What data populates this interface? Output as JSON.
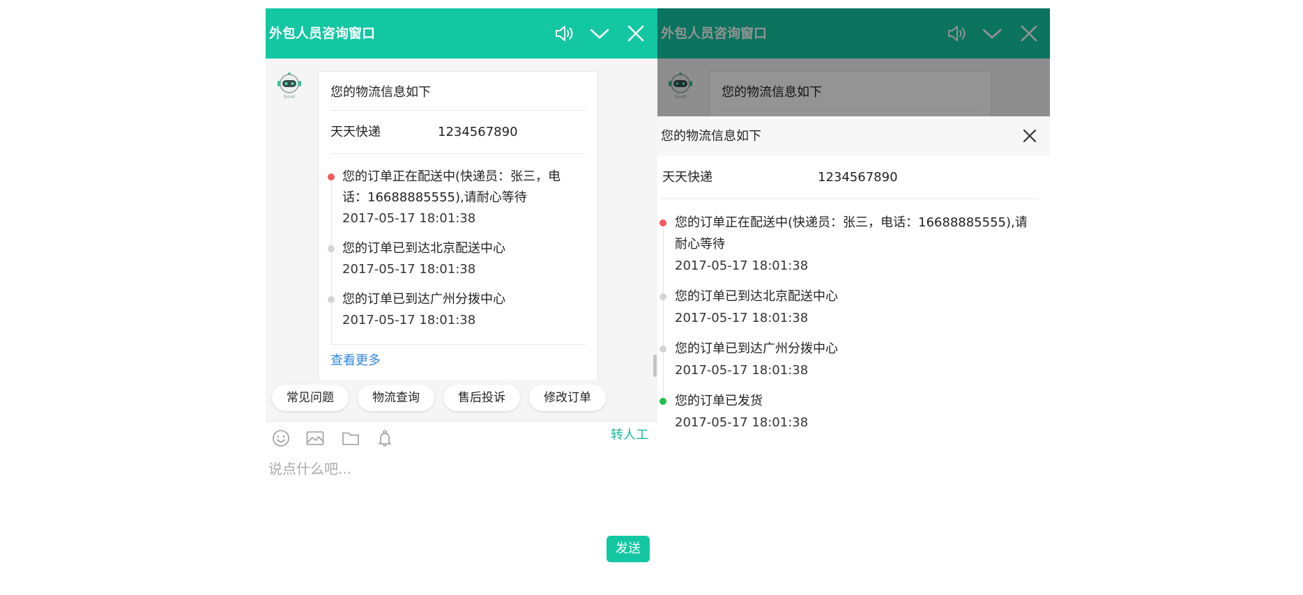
{
  "app": {
    "title": "外包人员咨询窗口",
    "accent_color": "#13c7a3",
    "header_icons": [
      "speaker-icon",
      "chevron-down-icon",
      "close-icon"
    ]
  },
  "chat": {
    "logistics_card": {
      "title": "您的物流信息如下",
      "carrier": "天天快递",
      "tracking_number": "1234567890",
      "events": [
        {
          "text": "您的订单正在配送中(快递员：张三，电话：16688885555),请耐心等待",
          "time": "2017-05-17 18:01:38",
          "dot_color": "#f25c5c"
        },
        {
          "text": "您的订单已到达北京配送中心",
          "time": "2017-05-17 18:01:38",
          "dot_color": "#d4d4d4"
        },
        {
          "text": "您的订单已到达广州分拨中心",
          "time": "2017-05-17 18:01:38",
          "dot_color": "#d4d4d4"
        }
      ],
      "more_link": "查看更多"
    },
    "quick_replies": [
      "常见问题",
      "物流查询",
      "售后投诉",
      "修改订单"
    ],
    "toolbar": {
      "icons": [
        "emoji-icon",
        "image-icon",
        "folder-icon",
        "bell-icon"
      ],
      "transfer_label": "转人工"
    },
    "input": {
      "placeholder": "说点什么吧...",
      "value": ""
    },
    "send_label": "发送"
  },
  "detail_panel": {
    "title": "您的物流信息如下",
    "carrier": "天天快递",
    "tracking_number": "1234567890",
    "events": [
      {
        "text": "您的订单正在配送中(快递员：张三，电话：16688885555),请耐心等待",
        "time": "2017-05-17 18:01:38",
        "dot_color": "#f25c5c"
      },
      {
        "text": "您的订单已到达北京配送中心",
        "time": "2017-05-17 18:01:38",
        "dot_color": "#d4d4d4"
      },
      {
        "text": "您的订单已到达广州分拨中心",
        "time": "2017-05-17 18:01:38",
        "dot_color": "#d4d4d4"
      },
      {
        "text": "您的订单已发货",
        "time": "2017-05-17 18:01:38",
        "dot_color": "#1fbf45"
      }
    ]
  }
}
